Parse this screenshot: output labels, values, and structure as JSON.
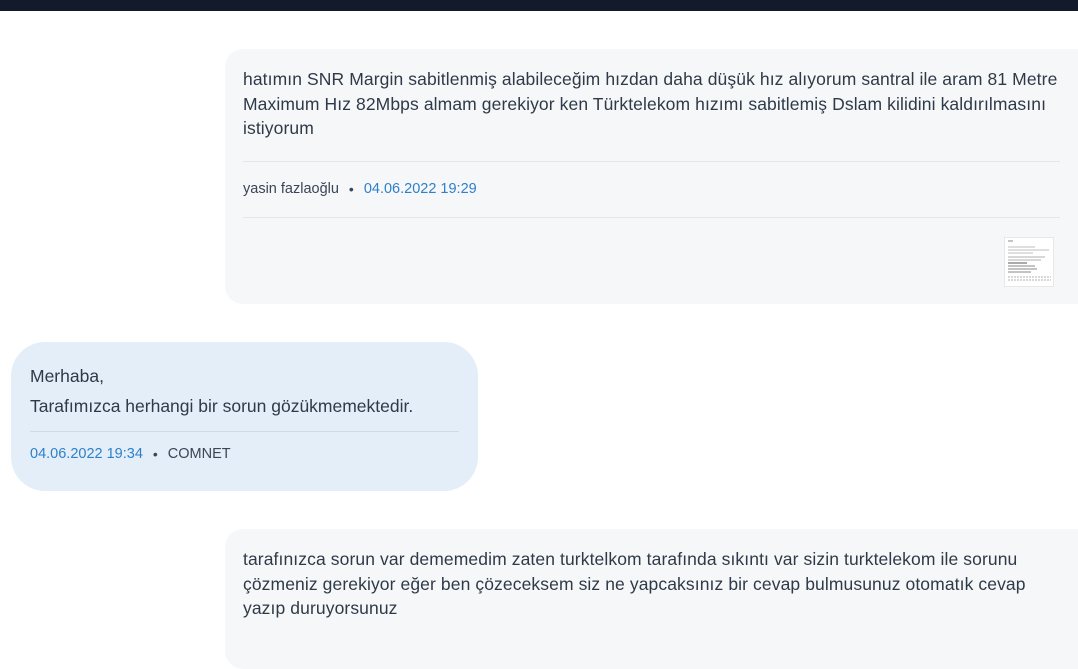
{
  "messages": [
    {
      "text": "hatımın SNR Margin sabitlenmiş alabileceğim hızdan daha düşük hız alıyorum santral ile aram 81 Metre Maximum Hız 82Mbps almam gerekiyor ken Türktelekom hızımı sabitlemiş Dslam kilidini kaldırılmasını istiyorum",
      "author": "yasin fazlaoğlu",
      "separator": "•",
      "date": "04.06.2022 19:29"
    },
    {
      "greeting": "Merhaba,",
      "text": "Tarafımızca herhangi bir sorun gözükmemektedir.",
      "date": "04.06.2022 19:34",
      "separator": "•",
      "company": "COMNET"
    },
    {
      "text": "tarafınızca sorun var dememedim zaten turktelkom tarafında sıkıntı var  sizin turktelekom ile sorunu çözmeniz gerekiyor  eğer ben çözeceksem siz ne yapcaksınız  bir cevap bulmusunuz otomatık cevap yazıp duruyorsunuz"
    }
  ],
  "colors": {
    "topbar": "#131a2c",
    "user_bubble": "#f6f7f9",
    "staff_bubble": "#e4eef8",
    "date_link": "#2d80c9"
  }
}
